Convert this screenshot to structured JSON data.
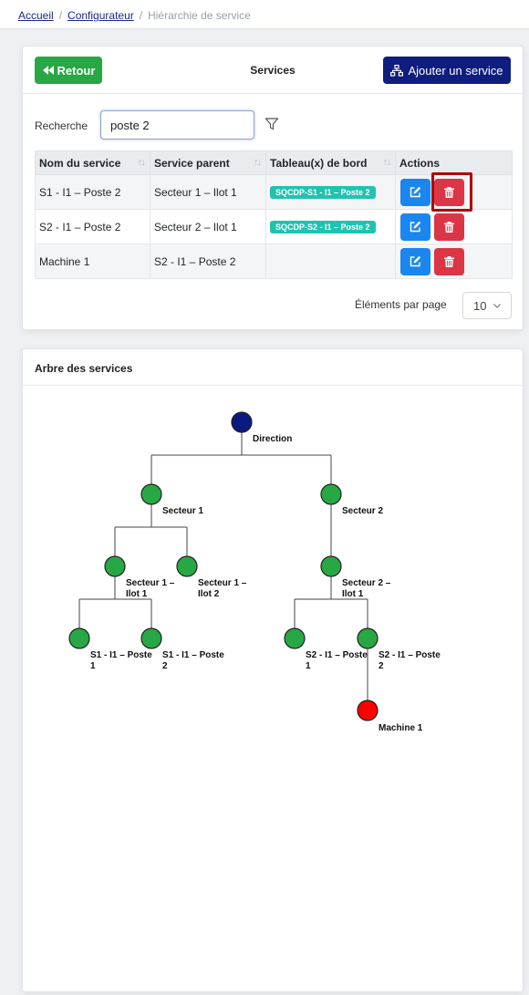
{
  "breadcrumb": {
    "home": "Accueil",
    "configurator": "Configurateur",
    "current": "Hiérarchie de service",
    "separator": "/"
  },
  "header": {
    "back_label": "Retour",
    "title": "Services",
    "add_label": "Ajouter un service"
  },
  "search": {
    "label": "Recherche",
    "value": "poste 2"
  },
  "table": {
    "columns": [
      "Nom du service",
      "Service parent",
      "Tableau(x) de bord",
      "Actions"
    ],
    "rows": [
      {
        "name": "S1 - I1 – Poste 2",
        "parent": "Secteur 1 – Ilot 1",
        "dashboard": "SQCDP-S1 - I1 – Poste 2"
      },
      {
        "name": "S2 - I1 – Poste 2",
        "parent": "Secteur 2 – Ilot 1",
        "dashboard": "SQCDP-S2 - I1 – Poste 2"
      },
      {
        "name": "Machine 1",
        "parent": "S2 - I1 – Poste 2",
        "dashboard": ""
      }
    ]
  },
  "pagination": {
    "label": "Éléments par page",
    "value": "10"
  },
  "tree": {
    "title": "Arbre des services",
    "nodes": {
      "direction": [
        "Direction"
      ],
      "secteur1": [
        "Secteur 1"
      ],
      "secteur2": [
        "Secteur 2"
      ],
      "s1ilot1": [
        "Secteur 1 –",
        "Ilot 1"
      ],
      "s1ilot2": [
        "Secteur 1 –",
        "Ilot 2"
      ],
      "s2ilot1": [
        "Secteur 2 –",
        "Ilot 1"
      ],
      "s1p1": [
        "S1 - I1 – Poste",
        "1"
      ],
      "s1p2": [
        "S1 - I1 – Poste",
        "2"
      ],
      "s2p1": [
        "S2 - I1 – Poste",
        "1"
      ],
      "s2p2": [
        "S2 - I1 – Poste",
        "2"
      ],
      "machine1": [
        "Machine 1"
      ]
    }
  },
  "colors": {
    "green": "#28a745",
    "navy": "#0f1d7e",
    "teal": "#20c3b0",
    "blue": "#1a86f0",
    "red": "#dc3545",
    "node_green": "#28a745",
    "node_navy": "#0a1a80",
    "node_red": "#ff0000"
  },
  "icons": {
    "back": "double-chevron-left-icon",
    "add": "sitemap-icon",
    "filter": "filter-icon",
    "edit": "pencil-square-icon",
    "delete": "trash-icon",
    "sort": "sort-arrows-icon",
    "select": "chevron-down-icon"
  }
}
